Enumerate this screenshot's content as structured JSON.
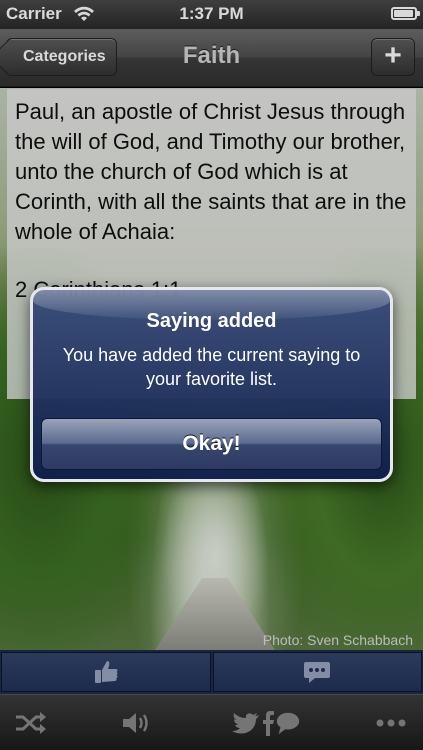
{
  "status_bar": {
    "carrier": "Carrier",
    "time": "1:37 PM"
  },
  "nav": {
    "back_label": "Categories",
    "title": "Faith",
    "add_label": "+"
  },
  "saying": {
    "text": "Paul, an apostle of Christ Jesus through the will of God, and Timothy our brother, unto the church of God which is at Corinth, with all the saints that are in the whole of Achaia:",
    "reference": "2 Corinthians 1:1"
  },
  "photo_credit": "Photo: Sven Schabbach",
  "action_bar": {
    "icons": [
      "thumbs-up-icon",
      "comment-icon"
    ]
  },
  "toolbar": {
    "icons": [
      "shuffle-icon",
      "speaker-icon",
      "twitter-icon",
      "facebook-icon",
      "chat-bubble-icon",
      "more-icon"
    ]
  },
  "alert": {
    "title": "Saying added",
    "message": "You have added the current saying to your favorite list.",
    "button_label": "Okay!"
  },
  "colors": {
    "nav_bar": "#444444",
    "action_bar": "#22325a",
    "alert": "#1f3270"
  }
}
